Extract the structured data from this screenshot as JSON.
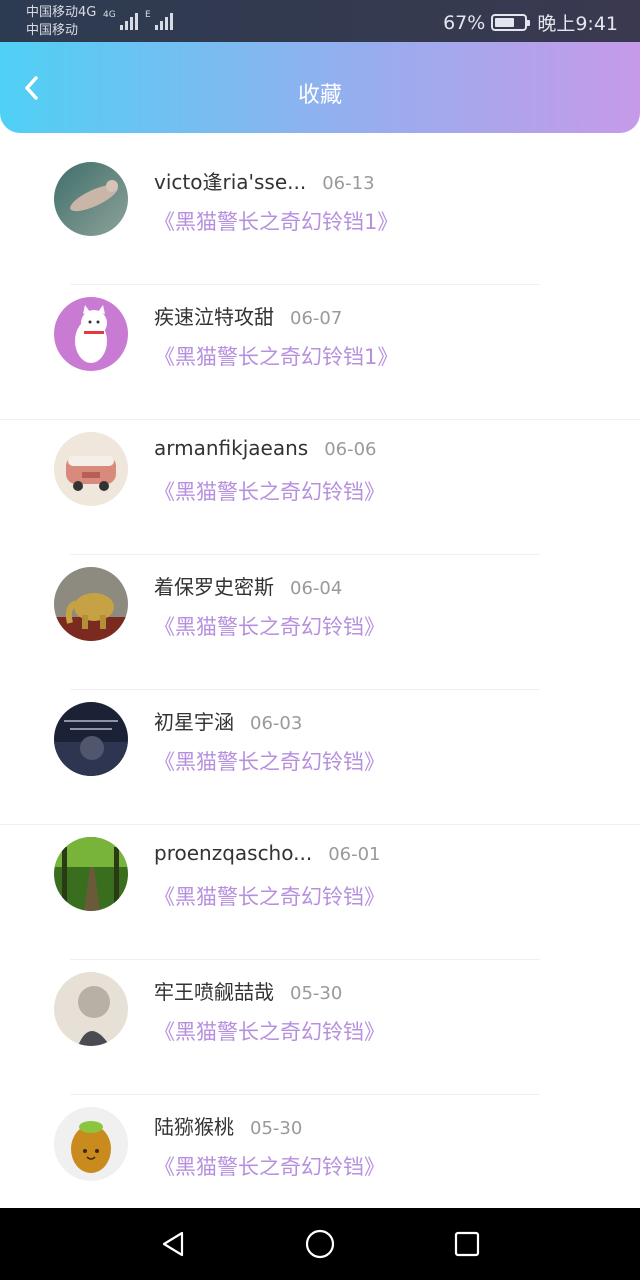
{
  "status_bar": {
    "carrier_line1": "中国移动4G",
    "carrier_line2": "中国移动",
    "signal1_tag": "4G",
    "signal2_tag": "E",
    "battery_percent": "67%",
    "battery_level": 0.67,
    "time": "晚上9:41"
  },
  "header": {
    "title": "收藏",
    "back_icon": "chevron-left-icon"
  },
  "favorites": [
    {
      "name": "victo逢ria'sse...",
      "date": "06-13",
      "book": "《黑猫警长之奇幻铃铛1》"
    },
    {
      "name": "疾速泣特攻甜",
      "date": "06-07",
      "book": "《黑猫警长之奇幻铃铛1》"
    },
    {
      "name": "armanfikjaeans",
      "date": "06-06",
      "book": "《黑猫警长之奇幻铃铛》"
    },
    {
      "name": "着保罗史密斯",
      "date": "06-04",
      "book": "《黑猫警长之奇幻铃铛》"
    },
    {
      "name": "初星宇涵",
      "date": "06-03",
      "book": "《黑猫警长之奇幻铃铛》"
    },
    {
      "name": "proenzqascho...",
      "date": "06-01",
      "book": "《黑猫警长之奇幻铃铛》"
    },
    {
      "name": "牢王喷觎喆哉",
      "date": "05-30",
      "book": "《黑猫警长之奇幻铃铛》"
    },
    {
      "name": "陆猕猴桃",
      "date": "05-30",
      "book": "《黑猫警长之奇幻铃铛》"
    }
  ],
  "nav_bar": {
    "back": "triangle-back-icon",
    "home": "circle-home-icon",
    "recents": "square-recents-icon"
  },
  "colors": {
    "header_start": "#4fd0f4",
    "header_end": "#c69ae9",
    "book_title": "#b690df",
    "date": "#9a9a9a"
  }
}
